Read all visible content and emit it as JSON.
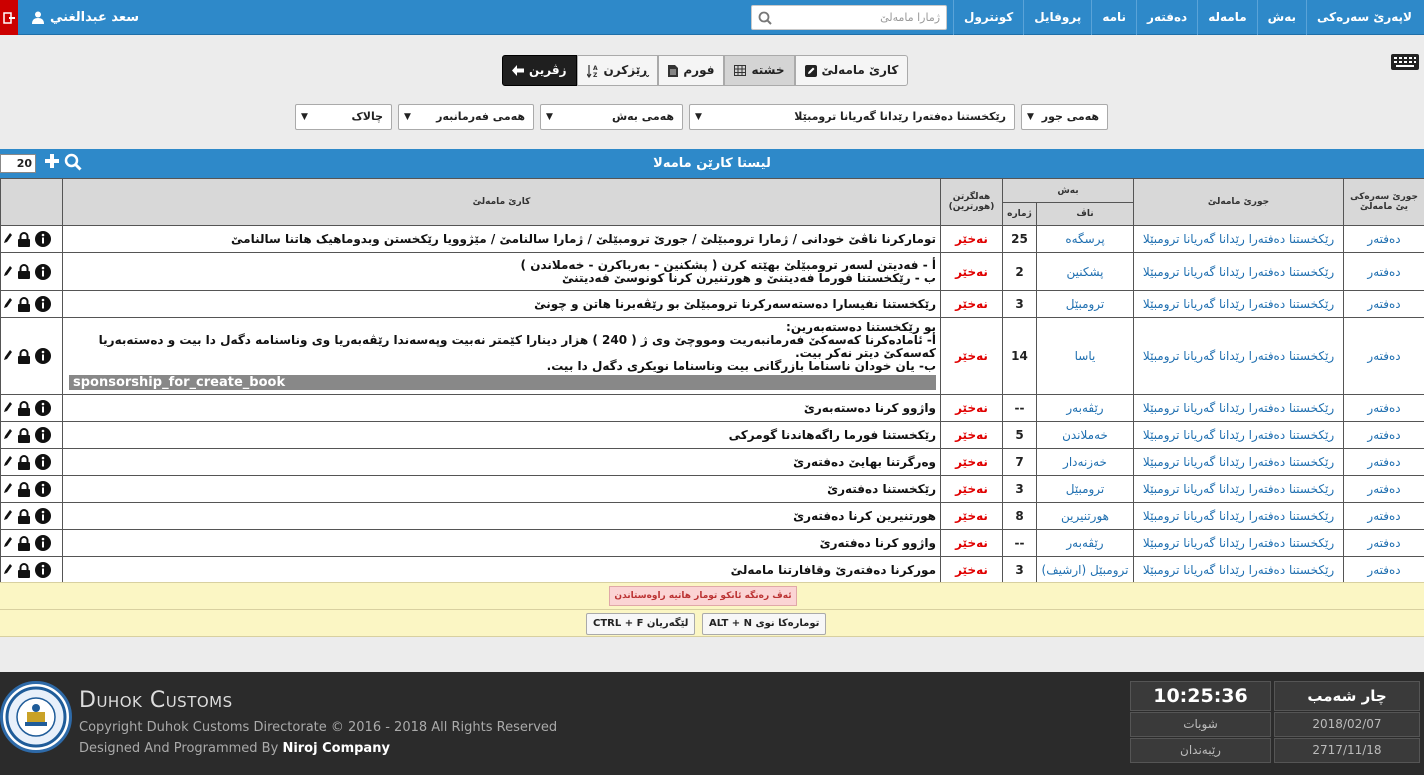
{
  "nav": {
    "items": [
      "لاپەرێ سەرەکی",
      "بەش",
      "مامەلە",
      "دەفتەر",
      "نامە",
      "پروفايل",
      "کونترول"
    ],
    "search_placeholder": "ژمارا مامەلێ",
    "user_name": "سعد عبدالغني"
  },
  "toolbar": {
    "back": "زڤرین",
    "sort": "ڕێزکرن",
    "form": "فورم",
    "grid": "خشتە",
    "work": "کارێ مامەلێ"
  },
  "filters": {
    "type": "هەمی جور",
    "book": "رێکخستنا دەفتەرا رێدانا گەریانا ترومبێلا",
    "section": "هەمی بەش",
    "employee": "هەمی فەرمانبەر",
    "status": "چالاک"
  },
  "panel": {
    "title": "لیستا کارێن مامەلا",
    "page_size": "20"
  },
  "table": {
    "headers": {
      "main_type": "جورێ سەرەکی یێ مامەلێ",
      "type": "جورێ مامەلێ",
      "section": "بەش",
      "name": "ناڤ",
      "number": "ژمارە",
      "archived": "هەلگرتن (هورترین)",
      "work": "کارێ مامەلێ"
    },
    "rows": [
      {
        "main": "دەفتەر",
        "type": "رێکخستنا دەفتەرا رێدانا گەریانا ترومبێلا",
        "section": "پرسگەه",
        "num": "25",
        "status": "نەخێر",
        "work": [
          "تومارکرنا ناڤێ خودانی / ژمارا ترومبێلێ / جورێ ترومبێلێ / ژمارا سالنامێ / مێژوویا رێکخستن وبدوماهیک هاتنا سالنامێ"
        ]
      },
      {
        "main": "دەفتەر",
        "type": "رێکخستنا دەفتەرا رێدانا گەریانا ترومبێلا",
        "section": "پشکنین",
        "num": "2",
        "status": "نەخێر",
        "work": [
          "أ - فەدیتن لسەر ترومبێلێ بهێتە کرن ( پشکنین - بەرباکرن - خەملاندن )",
          "ب - رێکخستنا فورما فەدیتنێ و هورتنیرن کرنا کونوسێ فەدیتنێ"
        ]
      },
      {
        "main": "دەفتەر",
        "type": "رێکخستنا دەفتەرا رێدانا گەریانا ترومبێلا",
        "section": "ترومبێل",
        "num": "3",
        "status": "نەخێر",
        "work": [
          "رێکخستنا نفیسارا دەستەسەرکرنا ترومبێلێ بو رێڤەبرنا هاتن و چونێ"
        ]
      },
      {
        "main": "دەفتەر",
        "type": "رێکخستنا دەفتەرا رێدانا گەریانا ترومبێلا",
        "section": "یاسا",
        "num": "14",
        "status": "نەخێر",
        "work": [
          "بو رێکخستنا دەستەبەرین:",
          "أ- ئامادەکرنا کەسەکێ فەرمانبەریت ومووچێ وی ژ ( 240 ) هزار دینارا کێمتر نەبیت وپەسەندا رێڤەبەریا وی وناسنامە دگەل دا بیت و دەستەبەریا کەسەکێ دیتر نەکر بیت.",
          "ب- یان خودان ناسناما بازرگانی بیت وناسناما نویکری دگەل دا بیت."
        ],
        "tag": "sponsorship_for_create_book"
      },
      {
        "main": "دەفتەر",
        "type": "رێکخستنا دەفتەرا رێدانا گەریانا ترومبێلا",
        "section": "رێڤەبەر",
        "num": "--",
        "status": "نەخێر",
        "work": [
          "واژوو کرنا دەستەبەرێ"
        ]
      },
      {
        "main": "دەفتەر",
        "type": "رێکخستنا دەفتەرا رێدانا گەریانا ترومبێلا",
        "section": "خەملاندن",
        "num": "5",
        "status": "نەخێر",
        "work": [
          "رێکخستنا فورما راگەهاندنا گومرکی"
        ]
      },
      {
        "main": "دەفتەر",
        "type": "رێکخستنا دەفتەرا رێدانا گەریانا ترومبێلا",
        "section": "خەزنەدار",
        "num": "7",
        "status": "نەخێر",
        "work": [
          "وەرگرتنا بهایێ دەفتەرێ"
        ]
      },
      {
        "main": "دەفتەر",
        "type": "رێکخستنا دەفتەرا رێدانا گەریانا ترومبێلا",
        "section": "ترومبێل",
        "num": "3",
        "status": "نەخێر",
        "work": [
          "رێکخستنا دەفتەرێ"
        ]
      },
      {
        "main": "دەفتەر",
        "type": "رێکخستنا دەفتەرا رێدانا گەریانا ترومبێلا",
        "section": "هورتنیرین",
        "num": "8",
        "status": "نەخێر",
        "work": [
          "هورتنیرین کرنا دەفتەرێ"
        ]
      },
      {
        "main": "دەفتەر",
        "type": "رێکخستنا دەفتەرا رێدانا گەریانا ترومبێلا",
        "section": "رێڤەبەر",
        "num": "--",
        "status": "نەخێر",
        "work": [
          "واژوو کرنا دەفتەرێ"
        ]
      },
      {
        "main": "دەفتەر",
        "type": "رێکخستنا دەفتەرا رێدانا گەریانا ترومبێلا",
        "section": "ترومبێل (ارشیف)",
        "num": "3",
        "status": "نەخێر",
        "work": [
          "مورکرنا دەفتەرێ وقافارتنا مامەلێ"
        ]
      }
    ]
  },
  "legend": {
    "badge": "ئەڤ رەنگە ئانکو تومار هاتیە راوەستاندن",
    "shortcut_new": "ALT + N تومارەکا نوی",
    "shortcut_find": "CTRL + F لێگەریان"
  },
  "footer": {
    "brand": "Duhok Customs",
    "copyright": "Copyright Duhok Customs Directorate © 2016 - 2018 All Rights Reserved",
    "designed_prefix": "Designed And Programmed By",
    "designed_by": "Niroj Company",
    "time": "10:25:36",
    "day": "چار شەمب",
    "month_ku": "شوبات",
    "date_greg": "2018/02/07",
    "label_kurdish": "رێبەندان",
    "date_kurdish": "2717/11/18"
  },
  "colors": {
    "primary": "#2e89c9",
    "danger": "#e00000",
    "link": "#1f6fb0",
    "legend_bg": "#fbf6c4"
  }
}
